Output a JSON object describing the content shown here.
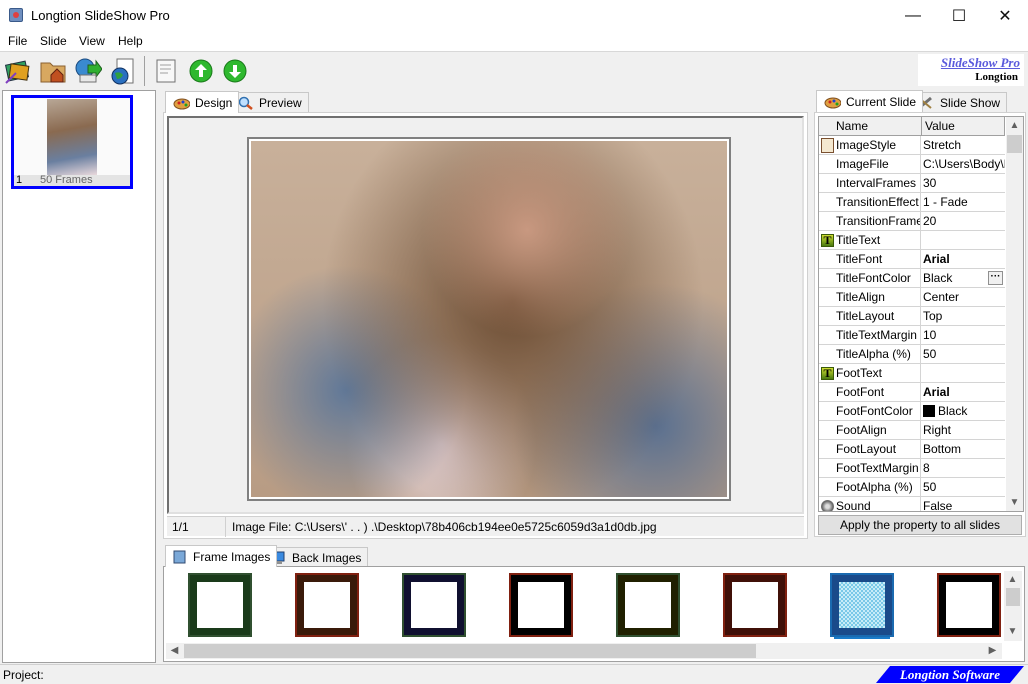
{
  "window": {
    "title": "Longtion SlideShow Pro",
    "controls": {
      "minimize": "—",
      "maximize": "☐",
      "close": "✕"
    }
  },
  "menu": [
    "File",
    "Slide",
    "View",
    "Help"
  ],
  "toolbar": {
    "buttons": [
      "new-project-icon",
      "open-project-icon",
      "save-project-icon",
      "publish-icon",
      "new-slide-icon",
      "move-up-icon",
      "move-down-icon"
    ]
  },
  "logo": {
    "line1": "SlideShow Pro",
    "line2": "Longtion"
  },
  "slides": [
    {
      "number": "1",
      "frames": "50 Frames"
    }
  ],
  "design": {
    "tabs": [
      "Design",
      "Preview"
    ],
    "active_tab": "Design",
    "status_count": "1/1",
    "status_file": "Image File: C:\\Users\\' . . ) .\\Desktop\\78b406cb194ee0e5725c6059d3a1d0db.jpg"
  },
  "properties": {
    "tabs": [
      "Current Slide",
      "Slide Show"
    ],
    "active_tab": "Current Slide",
    "columns": [
      "Name",
      "Value"
    ],
    "rows": [
      {
        "icon": "image-style-icon",
        "name": "ImageStyle",
        "value": "Stretch"
      },
      {
        "name": "ImageFile",
        "value": "C:\\Users\\Body\\D"
      },
      {
        "name": "IntervalFrames",
        "value": "30"
      },
      {
        "name": "TransitionEffect",
        "value": "1 - Fade"
      },
      {
        "name": "TransitionFrames",
        "value": "20"
      },
      {
        "icon": "text-icon",
        "name": "TitleText",
        "value": ""
      },
      {
        "name": "TitleFont",
        "value": "Arial",
        "bold": true
      },
      {
        "name": "TitleFontColor",
        "value": "Black",
        "ellipsis": true
      },
      {
        "name": "TitleAlign",
        "value": "Center"
      },
      {
        "name": "TitleLayout",
        "value": "Top"
      },
      {
        "name": "TitleTextMargin",
        "value": "10"
      },
      {
        "name": "TitleAlpha (%)",
        "value": "50"
      },
      {
        "icon": "text-icon",
        "name": "FootText",
        "value": ""
      },
      {
        "name": "FootFont",
        "value": "Arial",
        "bold": true
      },
      {
        "name": "FootFontColor",
        "value": "Black",
        "swatch": "#000000"
      },
      {
        "name": "FootAlign",
        "value": "Right"
      },
      {
        "name": "FootLayout",
        "value": "Bottom"
      },
      {
        "name": "FootTextMargin",
        "value": "8"
      },
      {
        "name": "FootAlpha (%)",
        "value": "50"
      },
      {
        "icon": "sound-icon",
        "name": "Sound",
        "value": "False"
      }
    ],
    "apply_button": "Apply the property to all slides"
  },
  "bottom": {
    "tabs": [
      "Frame Images",
      "Back Images"
    ],
    "active_tab": "Frame Images",
    "frames": [
      {
        "border": "#1a3a1a"
      },
      {
        "border": "#3a1a0a"
      },
      {
        "border": "#101030"
      },
      {
        "border": "#000000"
      },
      {
        "border": "#202000"
      },
      {
        "border": "#401008"
      },
      {
        "border": "#1a4a8a",
        "selected": true
      },
      {
        "border": "#000000"
      }
    ]
  },
  "statusbar": {
    "project_label": "Project:",
    "brand": "Longtion Software"
  }
}
